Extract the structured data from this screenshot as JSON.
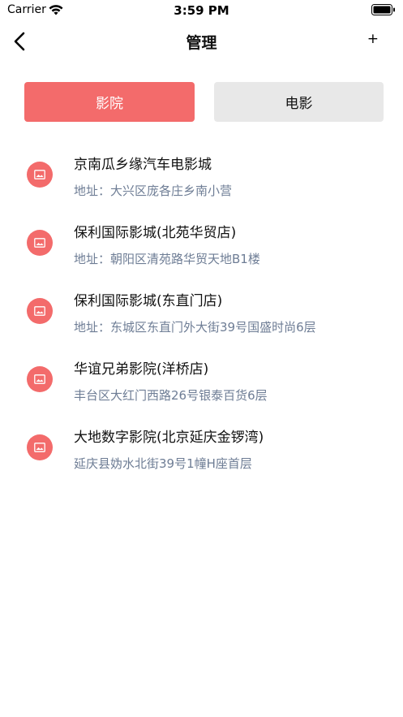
{
  "status_bar": {
    "carrier": "Carrier",
    "time": "3:59 PM"
  },
  "nav": {
    "title": "管理",
    "add_label": "+"
  },
  "segments": {
    "theater_label": "影院",
    "movie_label": "电影"
  },
  "colors": {
    "accent": "#f36b6b",
    "segment_inactive": "#e8e8e8",
    "address_text": "#6e7d95"
  },
  "theaters": [
    {
      "name": "京南瓜乡缘汽车电影城",
      "address": "地址：大兴区庞各庄乡南小营"
    },
    {
      "name": "保利国际影城(北苑华贸店)",
      "address": "地址：朝阳区清苑路华贸天地B1楼"
    },
    {
      "name": "保利国际影城(东直门店)",
      "address": "地址：东城区东直门外大街39号国盛时尚6层"
    },
    {
      "name": "华谊兄弟影院(洋桥店)",
      "address": "丰台区大红门西路26号银泰百货6层"
    },
    {
      "name": "大地数字影院(北京延庆金锣湾)",
      "address": "延庆县妫水北街39号1幢H座首层"
    }
  ]
}
